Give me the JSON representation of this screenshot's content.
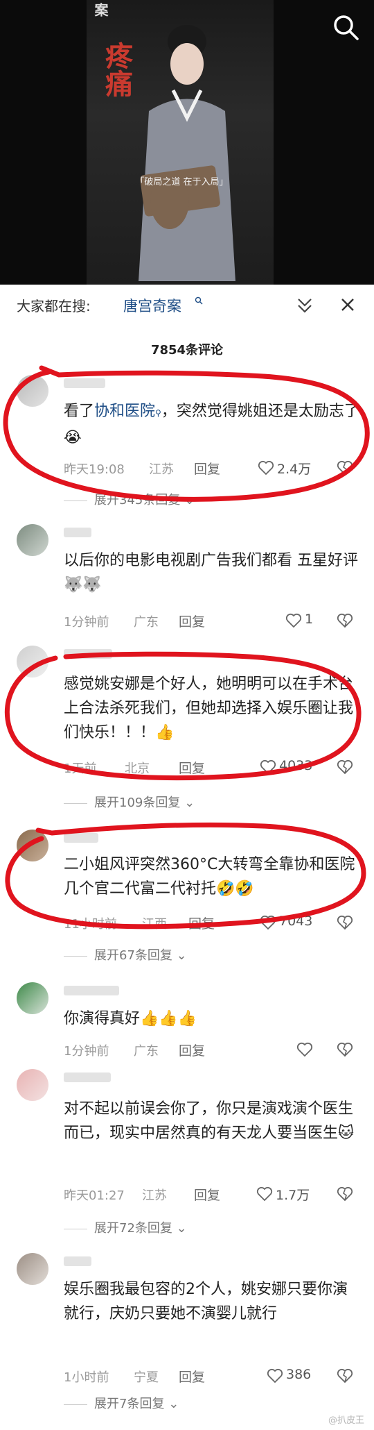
{
  "video": {
    "poster_vertical_title": "疼痛",
    "poster_corner": "案",
    "caption": "「破局之道 在于入局」"
  },
  "search_bar": {
    "prefix": "大家都在搜:",
    "keyword": "唐宫奇案",
    "keyword_icon": "search-icon"
  },
  "comments_header": {
    "title": "7854条评论"
  },
  "comments": [
    {
      "text_before": "看了",
      "link": "协和医院",
      "text_after": "，突然觉得姚姐还是太励志了😭",
      "time": "昨天19:08",
      "location": "江苏",
      "reply_label": "回复",
      "likes": "2.4万",
      "expand": "展开345条回复"
    },
    {
      "text": "以后你的电影电视剧广告我们都看 五星好评🐺🐺",
      "time": "1分钟前",
      "location": "广东",
      "reply_label": "回复",
      "likes": "1"
    },
    {
      "text": "感觉姚安娜是个好人，她明明可以在手术台上合法杀死我们，但她却选择入娱乐圈让我们快乐！！！👍",
      "time": "1天前",
      "location": "北京",
      "reply_label": "回复",
      "likes": "4033",
      "expand": "展开109条回复"
    },
    {
      "text": "二小姐风评突然360°C大转弯全靠协和医院几个官二代富二代衬托🤣🤣",
      "time": "11小时前",
      "location": "江西",
      "reply_label": "回复",
      "likes": "7043",
      "expand": "展开67条回复"
    },
    {
      "text": "你演得真好👍👍👍",
      "time": "1分钟前",
      "location": "广东",
      "reply_label": "回复",
      "likes": ""
    },
    {
      "text": "对不起以前误会你了，你只是演戏演个医生而已，现实中居然真的有天龙人要当医生🐱",
      "time": "昨天01:27",
      "location": "江苏",
      "reply_label": "回复",
      "likes": "1.7万",
      "expand": "展开72条回复"
    },
    {
      "text": "娱乐圈我最包容的2个人，姚安娜只要你演就行，庆奶只要她不演婴儿就行",
      "time": "1小时前",
      "location": "宁夏",
      "reply_label": "回复",
      "likes": "386",
      "expand": "展开7条回复"
    }
  ],
  "watermark": "@扒皮王",
  "colors": {
    "link": "#1f4e86",
    "annotation_red": "#e0141e"
  }
}
